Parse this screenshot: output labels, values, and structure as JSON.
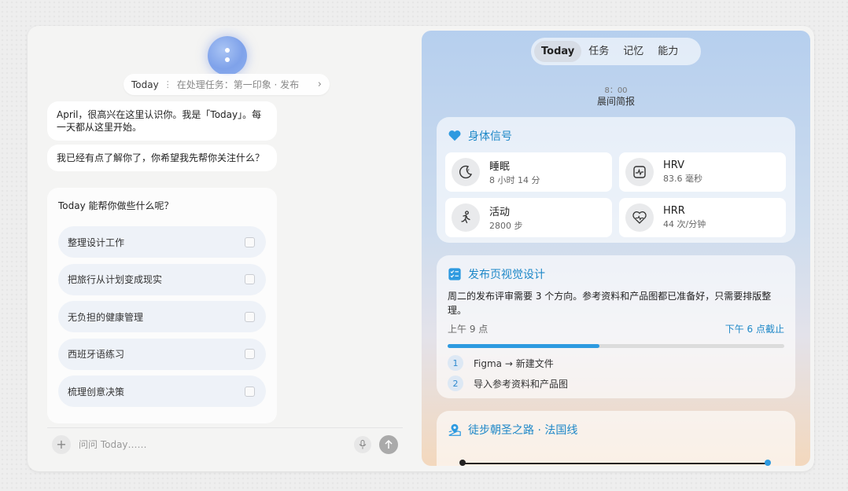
{
  "chat": {
    "status_mode": "Today",
    "status_task": "在处理任务：第一印象 · 发布",
    "greeting": "April，很高兴在这里认识你。我是「Today」。每一天都从这里开始。",
    "followup": "我已经有点了解你了，你希望我先帮你关注什么？",
    "question": "Today 能帮你做些什么呢？",
    "options": [
      {
        "label": "整理设计工作"
      },
      {
        "label": "把旅行从计划变成现实"
      },
      {
        "label": "无负担的健康管理"
      },
      {
        "label": "西班牙语练习"
      },
      {
        "label": "梳理创意决策"
      }
    ],
    "input_placeholder": "问问 Today……"
  },
  "dashboard": {
    "tabs": [
      {
        "label": "Today",
        "active": true
      },
      {
        "label": "任务"
      },
      {
        "label": "记忆"
      },
      {
        "label": "能力"
      }
    ],
    "time": "8：00",
    "brief_title": "晨间简报",
    "body_signals": {
      "title": "身体信号",
      "metrics": [
        {
          "name": "睡眠",
          "value": "8 小时 14 分",
          "icon": "sleep-icon"
        },
        {
          "name": "HRV",
          "value": "83.6 毫秒",
          "icon": "hrv-icon"
        },
        {
          "name": "活动",
          "value": "2800 步",
          "icon": "activity-icon"
        },
        {
          "name": "HRR",
          "value": "44 次/分钟",
          "icon": "heart-rate-icon"
        }
      ]
    },
    "task": {
      "title": "发布页视觉设计",
      "description": "周二的发布评审需要 3 个方向。参考资料和产品图都已准备好，只需要排版整理。",
      "start": "上午 9 点",
      "due": "下午 6 点截止",
      "progress": 0.45,
      "steps": [
        {
          "num": "1",
          "text": "Figma → 新建文件"
        },
        {
          "num": "2",
          "text": "导入参考资料和产品图"
        }
      ]
    },
    "route": {
      "title": "徒步朝圣之路 · 法国线"
    },
    "colors": {
      "accent": "#1e88c8",
      "progress": "#2e9ae0"
    }
  }
}
